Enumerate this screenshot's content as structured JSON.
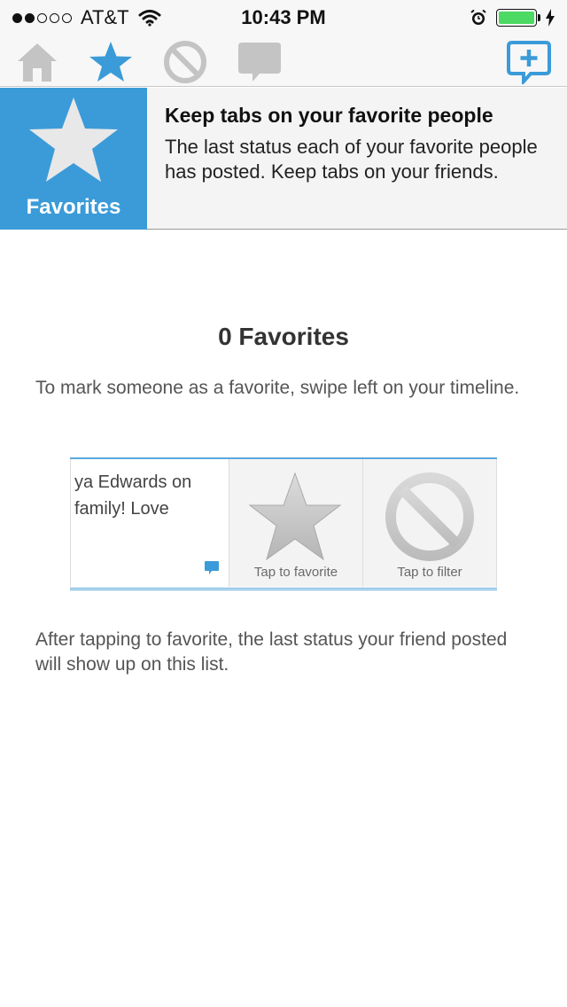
{
  "status_bar": {
    "carrier": "AT&T",
    "time": "10:43 PM",
    "signal_bars_filled": 2,
    "signal_bars_total": 5,
    "battery_level": 1.0,
    "icons": [
      "wifi-icon",
      "alarm-clock-icon",
      "battery-icon",
      "charging-bolt-icon"
    ]
  },
  "toolbar": {
    "icons": [
      "home-icon",
      "star-icon",
      "no-filter-icon",
      "speech-bubble-icon",
      "compose-icon"
    ],
    "active": "star-icon",
    "accent_color": "#3b9bd8",
    "inactive_color": "#c4c4c4"
  },
  "banner": {
    "badge_label": "Favorites",
    "title": "Keep tabs on your favorite people",
    "description": "The last status each of your favorite people has posted.  Keep tabs on your friends.",
    "badge_color": "#3b9bd8"
  },
  "main": {
    "count_title": "0 Favorites",
    "instruction": "To mark someone as a favorite, swipe left on your timeline.",
    "after_text": "After tapping to favorite, the last status your friend posted will show up on this list."
  },
  "illustration": {
    "tweet_line_1": "ya Edwards on",
    "tweet_line_2": "family! Love",
    "favorite_caption": "Tap to favorite",
    "filter_caption": "Tap to filter"
  }
}
